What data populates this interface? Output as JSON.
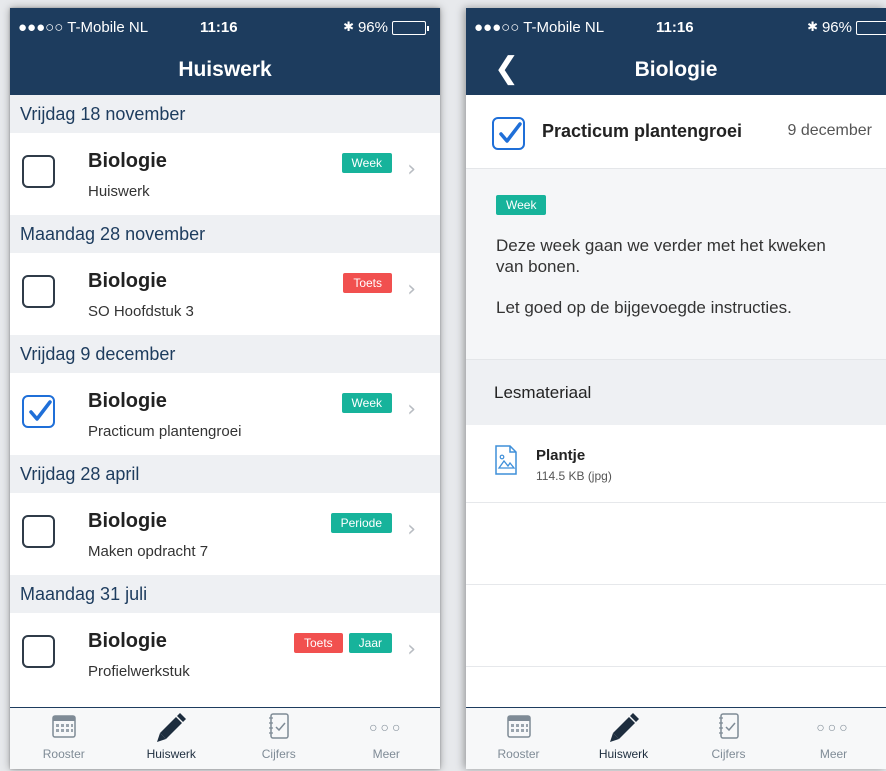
{
  "status": {
    "carrier": "●●●○○ T-Mobile NL",
    "time": "11:16",
    "battery": "96%"
  },
  "left": {
    "title": "Huiswerk",
    "sections": [
      {
        "date": "Vrijdag 18 november",
        "subject": "Biologie",
        "description": "Huiswerk",
        "badges": [
          "Week"
        ],
        "checked": false
      },
      {
        "date": "Maandag 28 november",
        "subject": "Biologie",
        "description": "SO Hoofdstuk 3",
        "badges": [
          "Toets"
        ],
        "checked": false
      },
      {
        "date": "Vrijdag 9 december",
        "subject": "Biologie",
        "description": "Practicum plantengroei",
        "badges": [
          "Week"
        ],
        "checked": true
      },
      {
        "date": "Vrijdag 28 april",
        "subject": "Biologie",
        "description": "Maken opdracht 7",
        "badges": [
          "Periode"
        ],
        "checked": false
      },
      {
        "date": "Maandag 31 juli",
        "subject": "Biologie",
        "description": "Profielwerkstuk",
        "badges": [
          "Toets",
          "Jaar"
        ],
        "checked": false
      }
    ]
  },
  "right": {
    "title": "Biologie",
    "item_title": "Practicum plantengroei",
    "item_date": "9 december",
    "badge": "Week",
    "paragraph1": "Deze week gaan we verder met het kweken van bonen.",
    "paragraph2": "Let goed op de bijgevoegde instructies.",
    "lesmateriaal_label": "Lesmateriaal",
    "file": {
      "name": "Plantje",
      "meta": "114.5 KB (jpg)"
    }
  },
  "tabs": [
    {
      "label": "Rooster",
      "icon": "calendar-icon"
    },
    {
      "label": "Huiswerk",
      "icon": "pencil-icon"
    },
    {
      "label": "Cijfers",
      "icon": "grades-icon"
    },
    {
      "label": "Meer",
      "icon": "more-icon"
    }
  ],
  "colors": {
    "nav": "#1d3c5e",
    "badge_green": "#17b39b",
    "badge_red": "#f1504f",
    "check_blue": "#1f6fd8"
  }
}
